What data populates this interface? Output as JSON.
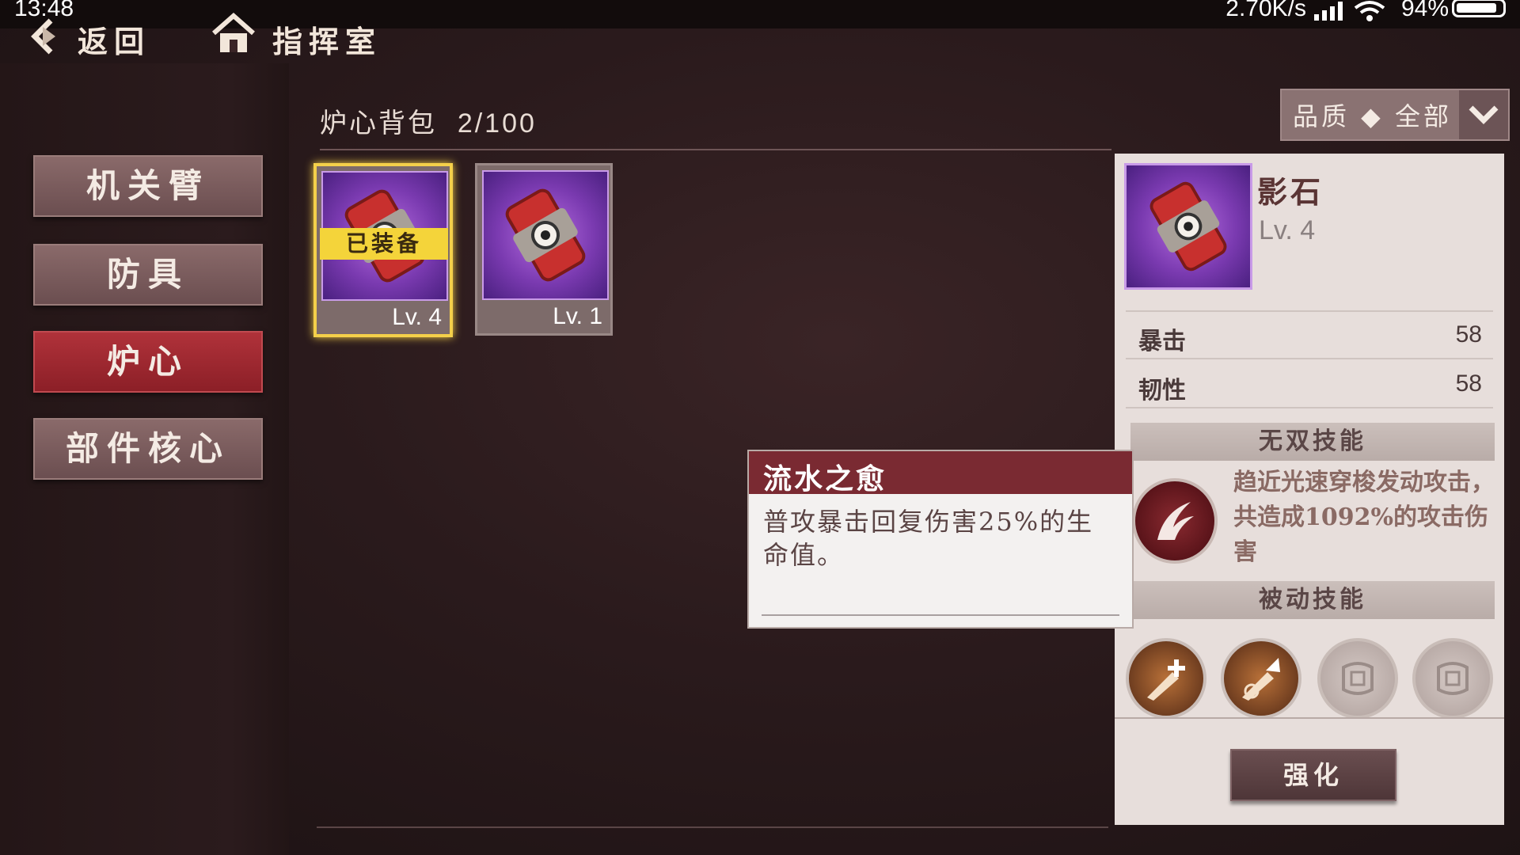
{
  "status_bar": {
    "time": "13:48",
    "net_speed": "2.70K/s",
    "battery": "94%"
  },
  "nav": {
    "back_label": "返回",
    "home_label": "指挥室"
  },
  "sidebar": {
    "items": [
      {
        "label": "机关臂"
      },
      {
        "label": "防具"
      },
      {
        "label": "炉心",
        "active": true
      },
      {
        "label": "部件核心"
      }
    ]
  },
  "bag": {
    "title": "炉心背包",
    "count": "2/100"
  },
  "filter": {
    "label": "品质 ◆ 全部"
  },
  "inventory": [
    {
      "level": "Lv. 4",
      "badge": "已装备",
      "selected": true
    },
    {
      "level": "Lv. 1"
    }
  ],
  "detail": {
    "name": "影石",
    "level": "Lv. 4",
    "stats": [
      {
        "key": "暴击",
        "value": "58"
      },
      {
        "key": "韧性",
        "value": "58"
      }
    ],
    "ult_header": "无双技能",
    "ult_desc": "趋近光速穿梭发动攻击，共造成1092%的攻击伤害",
    "passive_header": "被动技能",
    "passive_icons": [
      "sword-heal-icon",
      "sword-upgrade-icon",
      "locked-emblem-icon",
      "locked-emblem-icon"
    ],
    "upgrade_label": "强化"
  },
  "tooltip": {
    "title": "流水之愈",
    "body": "普攻暴击回复伤害25%的生命值。"
  },
  "colors": {
    "active_tab": "#a02a33",
    "card_bg": "#8a45c0",
    "equipped_badge": "#f4d43a",
    "tooltip_header": "#7a2a32"
  }
}
